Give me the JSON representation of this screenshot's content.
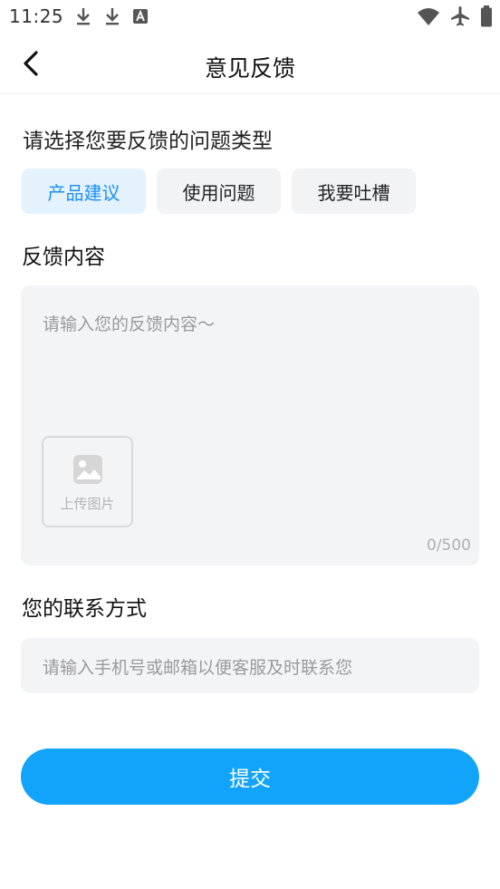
{
  "status_bar": {
    "time": "11:25",
    "left_icons": [
      "download-icon",
      "download-icon",
      "font-a-icon"
    ],
    "right_icons": [
      "wifi-icon",
      "airplane-icon",
      "battery-icon"
    ]
  },
  "nav": {
    "title": "意见反馈",
    "back_icon": "chevron-left-icon"
  },
  "feedback_type": {
    "label": "请选择您要反馈的问题类型",
    "options": [
      {
        "label": "产品建议",
        "selected": true
      },
      {
        "label": "使用问题",
        "selected": false
      },
      {
        "label": "我要吐槽",
        "selected": false
      }
    ]
  },
  "content": {
    "label": "反馈内容",
    "placeholder": "请输入您的反馈内容～",
    "upload_label": "上传图片",
    "char_count": "0/500"
  },
  "contact": {
    "label": "您的联系方式",
    "placeholder": "请输入手机号或邮箱以便客服及时联系您"
  },
  "submit_label": "提交",
  "colors": {
    "accent": "#12a4fa",
    "chip_active_bg": "#e3f2fd",
    "chip_active_text": "#1e8ff0",
    "input_bg": "#f3f4f6"
  }
}
